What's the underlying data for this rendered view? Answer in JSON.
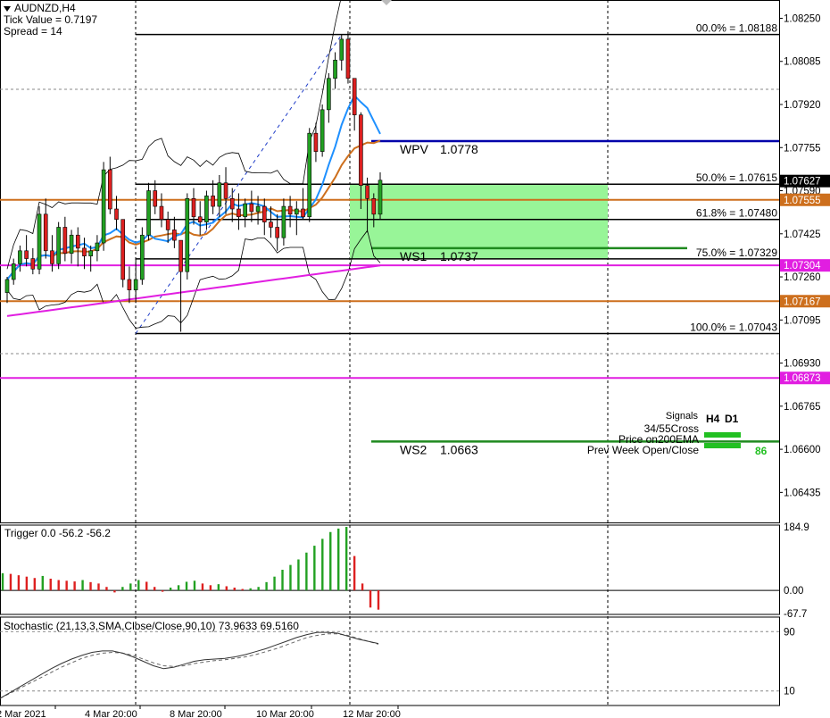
{
  "header": {
    "symbol": "AUDNZD,H4",
    "tick_value": "Tick Value = 0.7197",
    "spread": "Spread = 14"
  },
  "colors": {
    "bull": "#22a022",
    "bear": "#dd2020",
    "blue_ma": "#1e90ff",
    "brown_ma": "#cd6f1d",
    "magenta_ma": "#e11ee1",
    "pivot_blue": "#0000aa",
    "support_green": "#1f8a1f",
    "zone": "#98f598"
  },
  "chart_data": [
    {
      "type": "line",
      "title": "AUDNZD,H4",
      "ylim": [
        1.0632,
        1.0832
      ],
      "y_ticks": [
        "1.08250",
        "1.08085",
        "1.07920",
        "1.07755",
        "1.07590",
        "1.07425",
        "1.07260",
        "1.07095",
        "1.06930",
        "1.06765",
        "1.06600",
        "1.06435"
      ],
      "x_ticks": [
        "2 Mar 2021",
        "4 Mar 20:00",
        "8 Mar 20:00",
        "10 Mar 20:00",
        "12 Mar 20:00"
      ],
      "candles": [
        [
          1.072,
          1.0726,
          1.0716,
          1.0725
        ],
        [
          1.0725,
          1.0733,
          1.0723,
          1.0731
        ],
        [
          1.0731,
          1.0738,
          1.0728,
          1.0736
        ],
        [
          1.0736,
          1.0742,
          1.073,
          1.0733
        ],
        [
          1.0733,
          1.0737,
          1.0727,
          1.0729
        ],
        [
          1.0729,
          1.0753,
          1.0727,
          1.075
        ],
        [
          1.075,
          1.0756,
          1.0733,
          1.0736
        ],
        [
          1.0736,
          1.0742,
          1.0728,
          1.0731
        ],
        [
          1.0731,
          1.0747,
          1.0729,
          1.0745
        ],
        [
          1.0745,
          1.0749,
          1.0732,
          1.0735
        ],
        [
          1.0735,
          1.0744,
          1.0731,
          1.0742
        ],
        [
          1.0742,
          1.0745,
          1.073,
          1.0737
        ],
        [
          1.0737,
          1.0741,
          1.0729,
          1.0734
        ],
        [
          1.0734,
          1.0738,
          1.0728,
          1.0736
        ],
        [
          1.0736,
          1.0742,
          1.0732,
          1.0739
        ],
        [
          1.0739,
          1.077,
          1.0736,
          1.0767
        ],
        [
          1.0767,
          1.0772,
          1.075,
          1.0752
        ],
        [
          1.0752,
          1.0757,
          1.0744,
          1.0748
        ],
        [
          1.0748,
          1.0742,
          1.0722,
          1.0725
        ],
        [
          1.0725,
          1.073,
          1.0716,
          1.0721
        ],
        [
          1.0721,
          1.0733,
          1.0716,
          1.0725
        ],
        [
          1.0725,
          1.0745,
          1.0723,
          1.0742
        ],
        [
          1.0742,
          1.0762,
          1.074,
          1.0759
        ],
        [
          1.0759,
          1.0763,
          1.075,
          1.0753
        ],
        [
          1.0753,
          1.0758,
          1.0745,
          1.0748
        ],
        [
          1.0748,
          1.0751,
          1.0739,
          1.0744
        ],
        [
          1.0744,
          1.0749,
          1.0737,
          1.074
        ],
        [
          1.074,
          1.0738,
          1.0705,
          1.0728
        ],
        [
          1.0728,
          1.0758,
          1.0725,
          1.0756
        ],
        [
          1.0756,
          1.076,
          1.0746,
          1.0749
        ],
        [
          1.0749,
          1.0755,
          1.0742,
          1.0747
        ],
        [
          1.0747,
          1.0759,
          1.0744,
          1.0757
        ],
        [
          1.0757,
          1.0763,
          1.075,
          1.0753
        ],
        [
          1.0753,
          1.0765,
          1.0749,
          1.0762
        ],
        [
          1.0762,
          1.0768,
          1.075,
          1.0756
        ],
        [
          1.0756,
          1.076,
          1.0747,
          1.0752
        ],
        [
          1.0752,
          1.0758,
          1.0744,
          1.0749
        ],
        [
          1.0749,
          1.0756,
          1.0745,
          1.0754
        ],
        [
          1.0754,
          1.0759,
          1.0747,
          1.0751
        ],
        [
          1.0751,
          1.0757,
          1.0746,
          1.0753
        ],
        [
          1.0753,
          1.0756,
          1.0742,
          1.0747
        ],
        [
          1.0747,
          1.0753,
          1.0741,
          1.0745
        ],
        [
          1.0745,
          1.075,
          1.0736,
          1.0741
        ],
        [
          1.0741,
          1.0756,
          1.0738,
          1.0753
        ],
        [
          1.0753,
          1.0757,
          1.0745,
          1.075
        ],
        [
          1.075,
          1.0755,
          1.0742,
          1.0752
        ],
        [
          1.0752,
          1.076,
          1.0748,
          1.0749
        ],
        [
          1.0749,
          1.0783,
          1.0747,
          1.0781
        ],
        [
          1.0781,
          1.0785,
          1.077,
          1.0774
        ],
        [
          1.0774,
          1.0792,
          1.0772,
          1.079
        ],
        [
          1.079,
          1.0804,
          1.0785,
          1.0802
        ],
        [
          1.0802,
          1.0812,
          1.0798,
          1.0809
        ],
        [
          1.0809,
          1.0819,
          1.0805,
          1.0817
        ],
        [
          1.0817,
          1.082,
          1.08,
          1.0802
        ],
        [
          1.0802,
          1.0796,
          1.0782,
          1.0788
        ],
        [
          1.0788,
          1.0789,
          1.0752,
          1.0761
        ],
        [
          1.0761,
          1.0764,
          1.0743,
          1.0756
        ],
        [
          1.0756,
          1.0758,
          1.0745,
          1.075
        ],
        [
          1.075,
          1.0766,
          1.0748,
          1.0763
        ]
      ],
      "horizontal_levels": [
        {
          "label": "00.0% = 1.08188",
          "value": 1.08188,
          "color": "#000000"
        },
        {
          "label": "50.0% = 1.07615",
          "value": 1.07615,
          "color": "#000000"
        },
        {
          "label": "61.8% = 1.07480",
          "value": 1.0748,
          "color": "#000000"
        },
        {
          "label": "75.0% = 1.07329",
          "value": 1.07329,
          "color": "#000000"
        },
        {
          "label": "100.0% = 1.07043",
          "value": 1.07043,
          "color": "#000000"
        }
      ],
      "pivots": [
        {
          "name": "WPV",
          "value_text": "1.0778",
          "value": 1.0778,
          "color": "#0000aa"
        },
        {
          "name": "WS1",
          "value_text": "1.0737",
          "value": 1.0737,
          "color": "#1f8a1f"
        },
        {
          "name": "WS2",
          "value_text": "1.0663",
          "value": 1.0663,
          "color": "#1f8a1f"
        }
      ],
      "price_tags": [
        {
          "text": "1.07627",
          "value": 1.07627,
          "bg": "#000000",
          "fg": "#ffffff"
        },
        {
          "text": "1.07555",
          "value": 1.07555,
          "bg": "#cd6f1d",
          "fg": "#ffffff"
        },
        {
          "text": "1.07304",
          "value": 1.07304,
          "bg": "#e11ee1",
          "fg": "#ffffff"
        },
        {
          "text": "1.07167",
          "value": 1.07167,
          "bg": "#cd6f1d",
          "fg": "#ffffff"
        },
        {
          "text": "1.06873",
          "value": 1.06873,
          "bg": "#e11ee1",
          "fg": "#ffffff"
        }
      ],
      "extra_lines": [
        {
          "value": 1.07555,
          "color": "#cd6f1d"
        },
        {
          "value": 1.07304,
          "color": "#e11ee1"
        },
        {
          "value": 1.07167,
          "color": "#cd6f1d"
        },
        {
          "value": 1.06873,
          "color": "#e11ee1"
        }
      ],
      "zone": {
        "from": 1.07615,
        "to": 1.07329
      },
      "signals": {
        "title": "Signals",
        "columns": [
          "H4",
          "D1"
        ],
        "rows": [
          "34/55Cross",
          "Price on200EMA",
          "Prev Week Open/Close"
        ],
        "extra": "86"
      }
    },
    {
      "type": "bar",
      "title": "Trigger 0.0 -56.2 -56.2",
      "ylim": [
        -70,
        190
      ],
      "y_ticks": [
        "184.9",
        "0.00",
        "-67.7"
      ],
      "values": [
        50,
        48,
        44,
        40,
        36,
        42,
        34,
        30,
        28,
        26,
        30,
        24,
        20,
        10,
        -6,
        10,
        20,
        30,
        25,
        10,
        -4,
        8,
        15,
        25,
        28,
        20,
        15,
        18,
        12,
        8,
        4,
        6,
        10,
        24,
        40,
        60,
        74,
        90,
        110,
        130,
        150,
        170,
        180,
        184.9,
        100,
        20,
        -50,
        -56.2
      ]
    },
    {
      "type": "line",
      "title": "Stochastic (21,13,3,SMA,Close/Close,90,10) 73.9633 69.5160",
      "ylim": [
        0,
        100
      ],
      "y_ticks": [
        "90",
        "10"
      ],
      "main": [
        0,
        8,
        16,
        24,
        32,
        40,
        47,
        53,
        58,
        62,
        64,
        64,
        61,
        56,
        50,
        44,
        40,
        42,
        46,
        50,
        52,
        53,
        54,
        56,
        59,
        63,
        67,
        72,
        77,
        82,
        86,
        89,
        89,
        88,
        84,
        80,
        77,
        74
      ],
      "signal": [
        0,
        7,
        14,
        21,
        28,
        35,
        42,
        48,
        54,
        58,
        61,
        62,
        61,
        58,
        53,
        48,
        44,
        43,
        44,
        47,
        49,
        51,
        52,
        54,
        56,
        59,
        63,
        67,
        72,
        77,
        82,
        85,
        87,
        87,
        85,
        81,
        77,
        73
      ]
    }
  ]
}
